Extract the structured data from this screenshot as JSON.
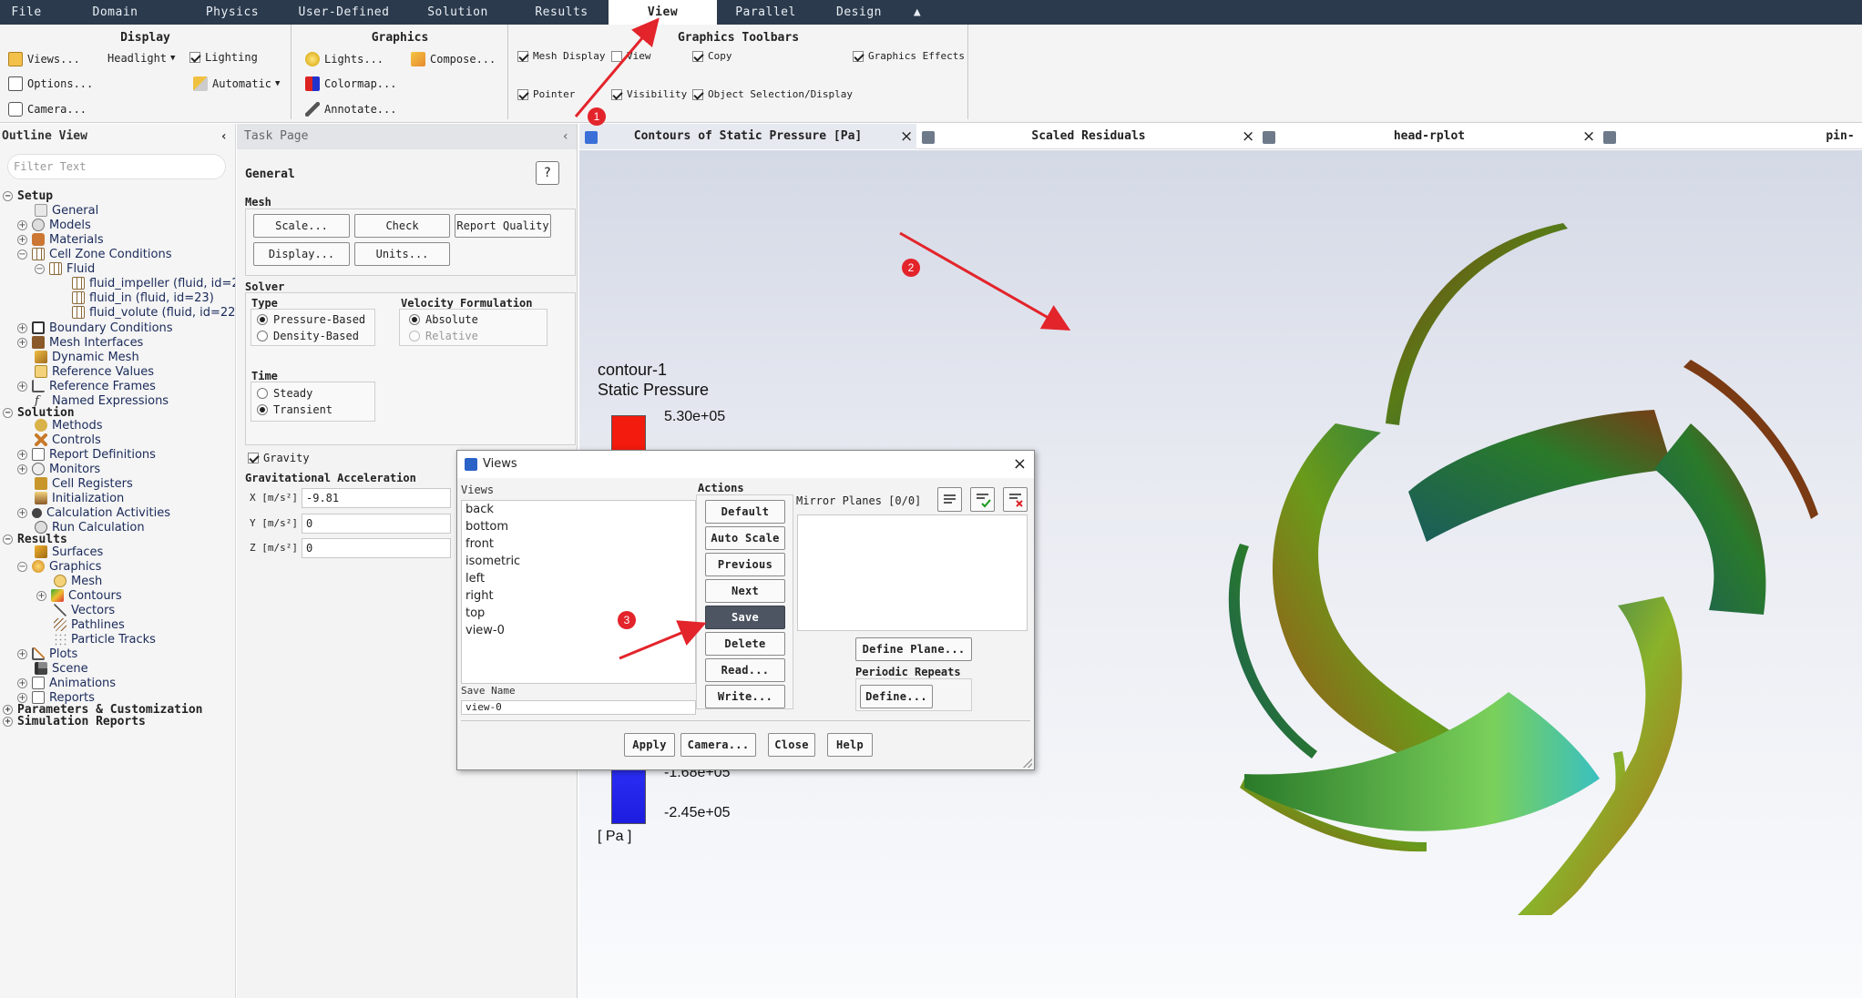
{
  "menu": [
    "File",
    "Domain",
    "Physics",
    "User-Defined",
    "Solution",
    "Results",
    "View",
    "Parallel",
    "Design"
  ],
  "menu_active": "View",
  "ribbon": {
    "display": {
      "title": "Display",
      "views": "Views...",
      "headlight": "Headlight",
      "lighting": "Lighting",
      "options": "Options...",
      "automatic": "Automatic",
      "camera": "Camera..."
    },
    "graphics": {
      "title": "Graphics",
      "lights": "Lights...",
      "compose": "Compose...",
      "colormap": "Colormap...",
      "annotate": "Annotate..."
    },
    "toolbars": {
      "title": "Graphics Toolbars",
      "mesh_display": "Mesh Display",
      "view": "View",
      "copy": "Copy",
      "graphics_effects": "Graphics Effects",
      "pointer": "Pointer",
      "visibility": "Visibility",
      "object_selection": "Object Selection/Display"
    }
  },
  "outline": {
    "title": "Outline View",
    "filter_placeholder": "Filter Text",
    "setup": "Setup",
    "general": "General",
    "models": "Models",
    "materials": "Materials",
    "cell_zone": "Cell Zone Conditions",
    "fluid": "Fluid",
    "fluid_impeller": "fluid_impeller (fluid, id=2",
    "fluid_in": "fluid_in (fluid, id=23)",
    "fluid_volute": "fluid_volute (fluid, id=22",
    "boundary": "Boundary Conditions",
    "mesh_interfaces": "Mesh Interfaces",
    "dynamic_mesh": "Dynamic Mesh",
    "reference_values": "Reference Values",
    "reference_frames": "Reference Frames",
    "named_expressions": "Named Expressions",
    "solution": "Solution",
    "methods": "Methods",
    "controls": "Controls",
    "report_defs": "Report Definitions",
    "monitors": "Monitors",
    "cell_registers": "Cell Registers",
    "initialization": "Initialization",
    "calc_activities": "Calculation Activities",
    "run_calc": "Run Calculation",
    "results": "Results",
    "surfaces": "Surfaces",
    "graphics": "Graphics",
    "mesh": "Mesh",
    "contours": "Contours",
    "vectors": "Vectors",
    "pathlines": "Pathlines",
    "particle_tracks": "Particle Tracks",
    "plots": "Plots",
    "scene": "Scene",
    "animations": "Animations",
    "reports": "Reports",
    "params": "Parameters & Customization",
    "sim_reports": "Simulation Reports"
  },
  "task": {
    "title": "Task Page",
    "general": "General",
    "mesh": "Mesh",
    "scale": "Scale...",
    "check": "Check",
    "report_quality": "Report Quality",
    "display": "Display...",
    "units": "Units...",
    "solver": "Solver",
    "type": "Type",
    "pressure_based": "Pressure-Based",
    "density_based": "Density-Based",
    "velocity_formulation": "Velocity Formulation",
    "absolute": "Absolute",
    "relative": "Relative",
    "time": "Time",
    "steady": "Steady",
    "transient": "Transient",
    "gravity": "Gravity",
    "grav_accel": "Gravitational Acceleration",
    "x_label": "X [m/s²]",
    "x_val": "-9.81",
    "y_label": "Y [m/s²]",
    "y_val": "0",
    "z_label": "Z [m/s²]",
    "z_val": "0"
  },
  "tabs": [
    {
      "label": "Contours of Static Pressure [Pa]",
      "active": true
    },
    {
      "label": "Scaled Residuals"
    },
    {
      "label": "head-rplot"
    },
    {
      "label": "pin-rplot"
    }
  ],
  "contour": {
    "name": "contour-1",
    "quantity": "Static Pressure",
    "max": "5.30e+05",
    "l1": "-1.68e+05",
    "min": "-2.45e+05",
    "unit": "[ Pa ]"
  },
  "dialog": {
    "title": "Views",
    "views_label": "Views",
    "views": [
      "back",
      "bottom",
      "front",
      "isometric",
      "left",
      "right",
      "top",
      "view-0"
    ],
    "actions_label": "Actions",
    "actions": [
      "Default",
      "Auto Scale",
      "Previous",
      "Next",
      "Save",
      "Delete",
      "Read...",
      "Write..."
    ],
    "selected_action": "Save",
    "mirror_planes": "Mirror Planes [0/0]",
    "define_plane": "Define Plane...",
    "periodic_repeats": "Periodic Repeats",
    "define": "Define...",
    "save_name_label": "Save Name",
    "save_name_value": "view-0",
    "footer": [
      "Apply",
      "Camera...",
      "Close",
      "Help"
    ]
  },
  "annotations": [
    "1",
    "2",
    "3"
  ],
  "colors": {
    "menubar": "#2b3a4c",
    "annotation": "#e3242b",
    "selected_button": "#4d5563"
  }
}
